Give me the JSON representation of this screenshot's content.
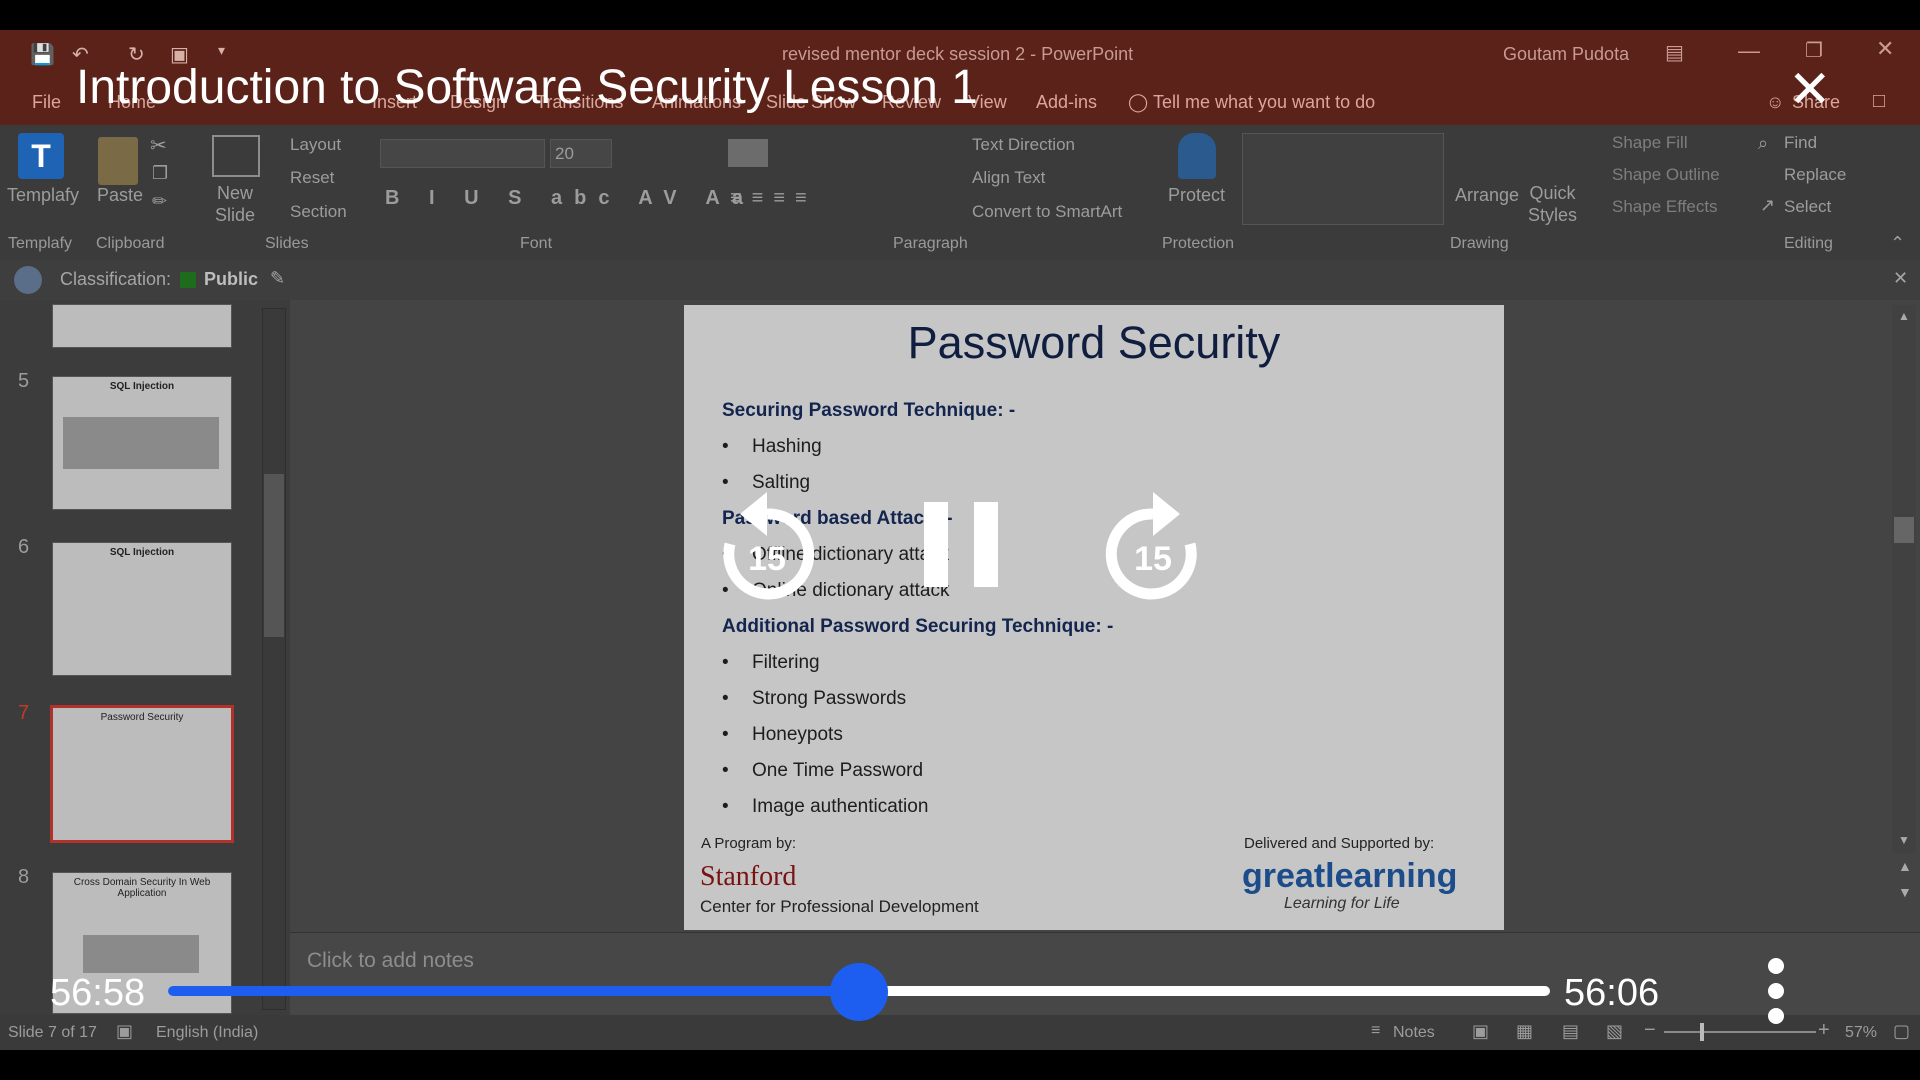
{
  "window": {
    "doc_title": "revised mentor deck session 2  -  PowerPoint",
    "user": "Goutam Pudota"
  },
  "video": {
    "title": "Introduction to Software Security Lesson 1",
    "elapsed": "56:58",
    "remaining": "56:06",
    "rewind_seconds": "15",
    "forward_seconds": "15",
    "progress": 0.5
  },
  "tabs": [
    "File",
    "Home",
    "Insert",
    "Design",
    "Transitions",
    "Animations",
    "Slide Show",
    "Review",
    "View",
    "Add-ins"
  ],
  "tellme": "Tell me what you want to do",
  "share": "Share",
  "ribbon": {
    "templafy": "Templafy",
    "paste": "Paste",
    "new_slide": "New\nSlide",
    "layout": "Layout",
    "reset": "Reset",
    "section": "Section",
    "font_size": "20",
    "text_direction": "Text Direction",
    "align_text": "Align Text",
    "convert_smartart": "Convert to SmartArt",
    "protect": "Protect",
    "arrange": "Arrange",
    "quick_styles": "Quick\nStyles",
    "shape_fill": "Shape Fill",
    "shape_outline": "Shape Outline",
    "shape_effects": "Shape Effects",
    "find": "Find",
    "replace": "Replace",
    "select": "Select",
    "groups": [
      "Templafy",
      "Clipboard",
      "Slides",
      "Font",
      "Paragraph",
      "Protection",
      "Drawing",
      "Editing"
    ]
  },
  "classification": {
    "label": "Classification:",
    "value": "Public"
  },
  "thumbs": [
    {
      "num": "5",
      "title": "SQL Injection"
    },
    {
      "num": "6",
      "title": "SQL Injection"
    },
    {
      "num": "7",
      "title": "Password Security"
    },
    {
      "num": "8",
      "title": "Cross Domain Security In Web Application"
    }
  ],
  "slide": {
    "title": "Password Security",
    "h1": "Securing Password Technique: -",
    "b1": [
      "Hashing",
      "Salting"
    ],
    "h2": "Password based Attack: -",
    "b2": [
      "Offline dictionary attack",
      "Online dictionary attack"
    ],
    "h3": "Additional Password Securing Technique: -",
    "b3": [
      "Filtering",
      "Strong Passwords",
      "Honeypots",
      "One Time Password",
      "Image authentication"
    ],
    "program_by": "A Program by:",
    "stanford": "Stanford",
    "stanford_sub": "Center for Professional Development",
    "delivered": "Delivered and Supported by:",
    "gl": "greatlearning",
    "gl_sub": "Learning for Life"
  },
  "notes_placeholder": "Click to add notes",
  "status": {
    "slide": "Slide 7 of 17",
    "language": "English (India)",
    "notes": "Notes",
    "zoom": "57%"
  }
}
